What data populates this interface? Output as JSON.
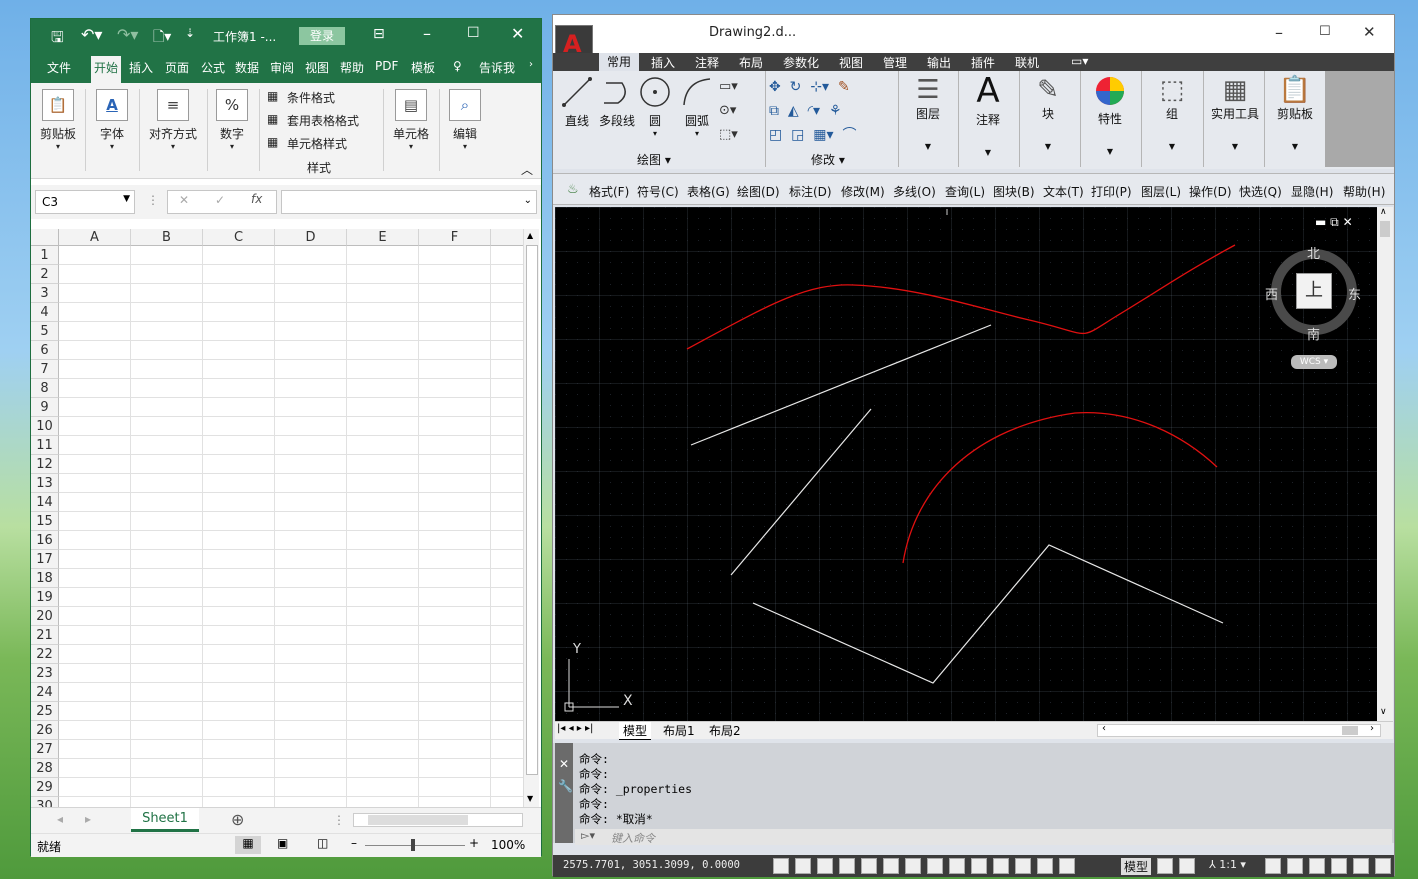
{
  "excel": {
    "qat_title": "工作簿1 -...",
    "login": "登录",
    "tabs": [
      "文件",
      "开始",
      "插入",
      "页面",
      "公式",
      "数据",
      "审阅",
      "视图",
      "帮助",
      "PDF",
      "模板"
    ],
    "tell_me": "告诉我",
    "ribbon": {
      "clipboard": "剪贴板",
      "font": "字体",
      "align": "对齐方式",
      "number": "数字",
      "cond_format": "条件格式",
      "table_format": "套用表格格式",
      "cell_styles": "单元格样式",
      "styles_group": "样式",
      "cells": "单元格",
      "editing": "编辑"
    },
    "namebox": "C3",
    "fx": "fx",
    "columns": [
      "A",
      "B",
      "C",
      "D",
      "E",
      "F"
    ],
    "rows": [
      "1",
      "2",
      "3",
      "4",
      "5",
      "6",
      "7",
      "8",
      "9",
      "10",
      "11",
      "12",
      "13",
      "14",
      "15",
      "16",
      "17",
      "18",
      "19",
      "20",
      "21",
      "22",
      "23",
      "24",
      "25",
      "26",
      "27",
      "28",
      "29",
      "30"
    ],
    "sheet_tab": "Sheet1",
    "status_ready": "就绪",
    "zoom": "100%"
  },
  "cad": {
    "title": "Drawing2.d...",
    "tabs": [
      "常用",
      "插入",
      "注释",
      "布局",
      "参数化",
      "视图",
      "管理",
      "输出",
      "插件",
      "联机"
    ],
    "draw_tools": {
      "line": "直线",
      "polyline": "多段线",
      "circle": "圆",
      "arc": "圆弧"
    },
    "panels": {
      "draw": "绘图",
      "modify": "修改"
    },
    "big_tools": {
      "layers": "图层",
      "annotation": "注释",
      "block": "块",
      "properties": "特性",
      "group": "组",
      "utilities": "实用工具",
      "clipboard": "剪贴板"
    },
    "menus": [
      "格式(F)",
      "符号(C)",
      "表格(G)",
      "绘图(D)",
      "标注(D)",
      "修改(M)",
      "多线(O)",
      "查询(L)",
      "图块(B)",
      "文本(T)",
      "打印(P)",
      "图层(L)",
      "操作(D)",
      "快选(Q)",
      "显隐(H)",
      "帮助(H)"
    ],
    "viewcube": {
      "north": "北",
      "south": "南",
      "east": "东",
      "west": "西",
      "top": "上",
      "wcs": "WCS"
    },
    "ucs": {
      "x": "X",
      "y": "Y"
    },
    "layouts": [
      "模型",
      "布局1",
      "布局2"
    ],
    "command_history": [
      "命令:",
      "命令:",
      "命令: _properties",
      "命令:",
      "命令: *取消*"
    ],
    "command_prompt": "键入命令",
    "coords": "2575.7701,  3051.3099,  0.0000",
    "status_model": "模型",
    "scale": "1:1"
  }
}
